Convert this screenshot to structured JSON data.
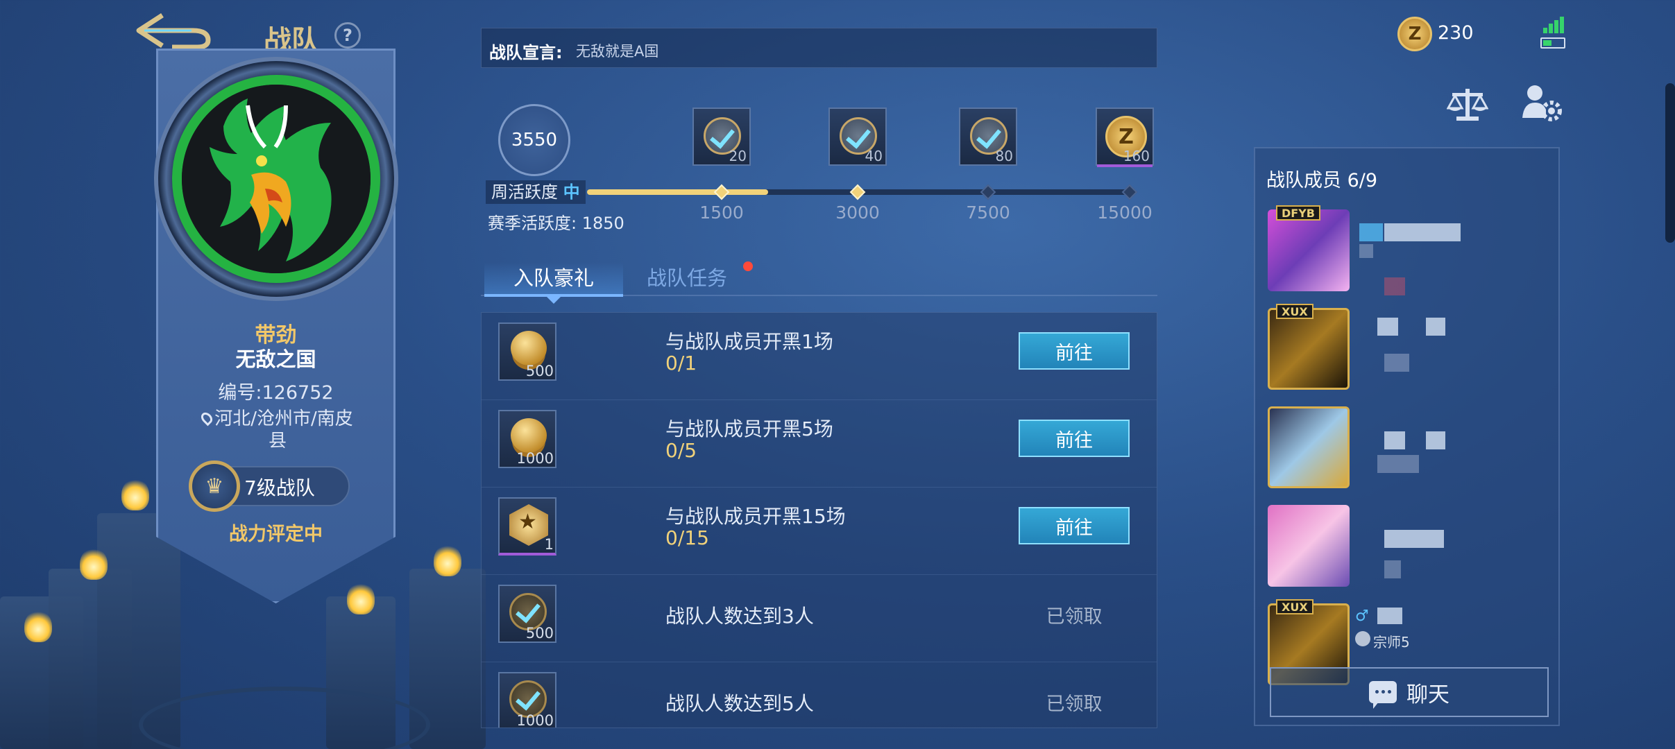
{
  "header": {
    "title": "战队",
    "help_icon": "?"
  },
  "team": {
    "tag": "带劲",
    "name": "无敌之国",
    "id_text": "编号:126752",
    "location": "河北/沧州市/南皮县",
    "level": "7级战队",
    "power_status": "战力评定中"
  },
  "declaration": {
    "label": "战队宣言:",
    "text": "无敌就是A国"
  },
  "activity": {
    "weekly_score": "3550",
    "weekly_label": "周活跃度",
    "weekly_level": "中",
    "season_text": "赛季活跃度: 1850",
    "progress_fraction": 0.3333,
    "milestones": [
      {
        "label": "1500",
        "reward_qty": "20",
        "claimed": true,
        "reached": true
      },
      {
        "label": "3000",
        "reward_qty": "40",
        "claimed": true,
        "reached": true
      },
      {
        "label": "7500",
        "reward_qty": "80",
        "claimed": true,
        "reached": false
      },
      {
        "label": "15000",
        "reward_qty": "160",
        "claimed": false,
        "reached": false
      }
    ]
  },
  "tabs": [
    {
      "label": "入队豪礼",
      "active": true
    },
    {
      "label": "战队任务",
      "active": false,
      "has_notification": true
    }
  ],
  "tasks": [
    {
      "title": "与战队成员开黑1场",
      "progress": "0/1",
      "reward_qty": "500",
      "reward_icon": "gold-coin-icon",
      "action": "前往"
    },
    {
      "title": "与战队成员开黑5场",
      "progress": "0/5",
      "reward_qty": "1000",
      "reward_icon": "gold-coin-icon",
      "action": "前往"
    },
    {
      "title": "与战队成员开黑15场",
      "progress": "0/15",
      "reward_qty": "1",
      "reward_icon": "star-medal-icon",
      "action": "前往"
    },
    {
      "title": "战队人数达到3人",
      "progress": "",
      "reward_qty": "500",
      "reward_icon": "checked-reward-icon",
      "action": "已领取"
    },
    {
      "title": "战队人数达到5人",
      "progress": "",
      "reward_qty": "1000",
      "reward_icon": "checked-reward-icon",
      "action": "已领取"
    }
  ],
  "currency": {
    "icon": "team-coin-icon",
    "value": "230"
  },
  "members": {
    "header": "战队成员 6/9",
    "rows": [
      {
        "avatar_tag": "DFYB"
      },
      {
        "avatar_tag": "XUX"
      },
      {
        "avatar_tag": ""
      },
      {
        "avatar_tag": ""
      },
      {
        "avatar_tag": "XUX",
        "gender": "♂",
        "rank": "宗师5"
      }
    ],
    "chat_label": "聊天"
  },
  "colors": {
    "accent_gold": "#f1d27a",
    "accent_blue": "#5cc4ff",
    "button_blue": "#2284b9",
    "notification_red": "#ff4a3a",
    "emblem_green": "#25b342"
  }
}
